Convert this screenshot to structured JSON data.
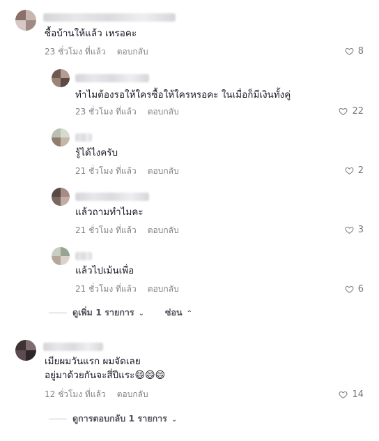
{
  "comments": [
    {
      "text": "ซื้อบ้านให้แล้ว เหรอคะ",
      "time": "23 ชั่วโมง ที่แล้ว",
      "reply_label": "ตอบกลับ",
      "likes": "8",
      "replies": [
        {
          "text": "ทำไมต้องรอให้ใครซื้อให้ใครหรอคะ ในเมื่อก็มีเงินทั้งคู่",
          "time": "23 ชั่วโมง ที่แล้ว",
          "reply_label": "ตอบกลับ",
          "likes": "22"
        },
        {
          "text": "รู้ได้ไงครับ",
          "time": "21 ชั่วโมง ที่แล้ว",
          "reply_label": "ตอบกลับ",
          "likes": "2"
        },
        {
          "text": "แล้วถามทำไมคะ",
          "time": "21 ชั่วโมง ที่แล้ว",
          "reply_label": "ตอบกลับ",
          "likes": "3"
        },
        {
          "text": "แล้วไปเม้นเพื่อ",
          "time": "21 ชั่วโมง ที่แล้ว",
          "reply_label": "ตอบกลับ",
          "likes": "6"
        }
      ],
      "view_more": "ดูเพิ่ม 1 รายการ",
      "hide": "ซ่อน"
    },
    {
      "text_line1": "เมียผมวันแรก ผมจัดเลย",
      "text_line2": "อยู่มาด้วยกันจะสี่ปีแระ",
      "emoji": "😄😄😄",
      "time": "12 ชั่วโมง ที่แล้ว",
      "reply_label": "ตอบกลับ",
      "likes": "14",
      "view_replies": "ดูการตอบกลับ 1 รายการ"
    }
  ],
  "colors": {
    "text": "#161823",
    "muted": "#8a8b91"
  }
}
